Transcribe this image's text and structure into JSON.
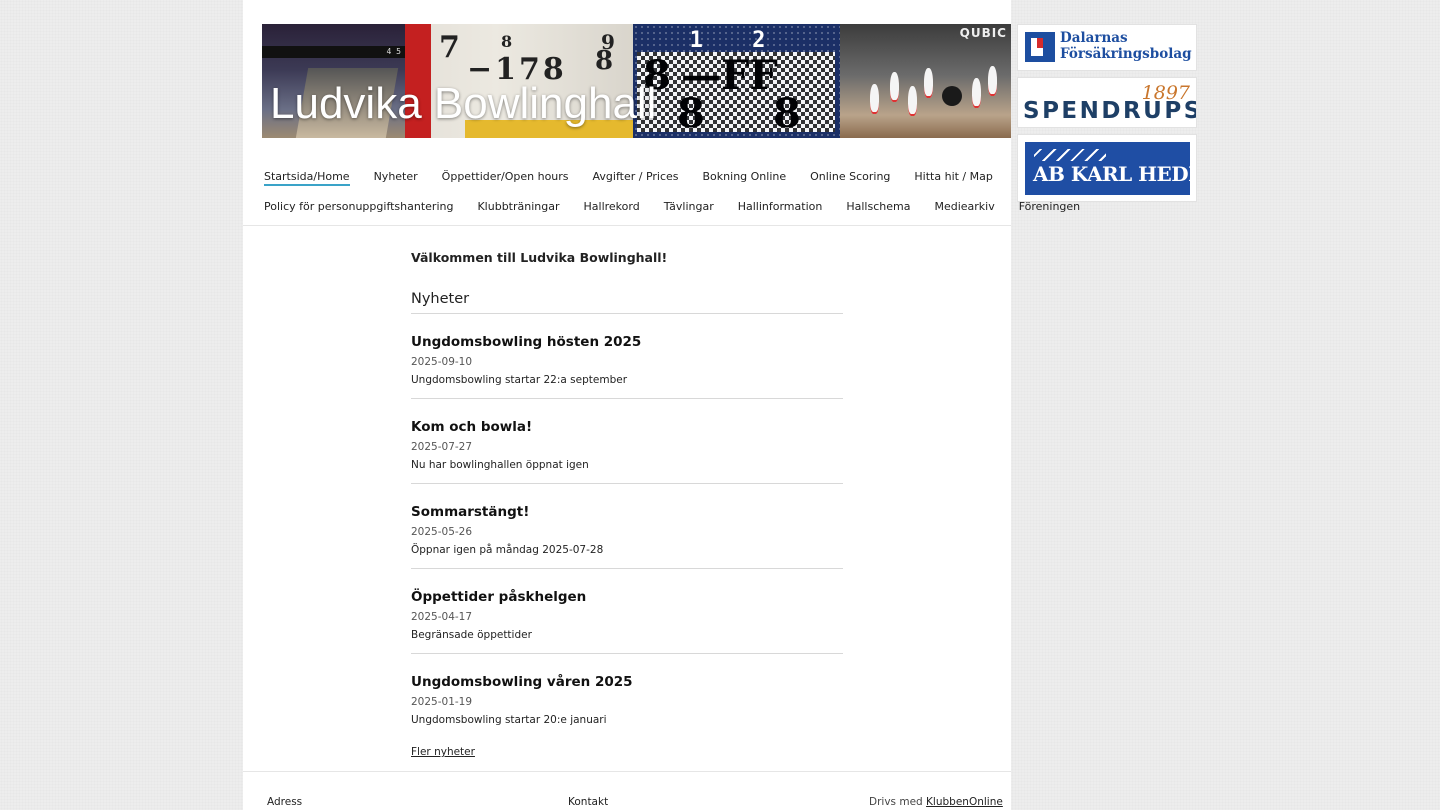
{
  "site": {
    "title": "Ludvika Bowlinghall"
  },
  "banner": {
    "panel1_strip": "4 5",
    "panel2_numbers": [
      "7",
      "8",
      "9",
      "−178",
      "8"
    ],
    "panel3_top": "1 2",
    "panel3_marks": [
      "8",
      "—FF",
      "8",
      "8"
    ],
    "panel4_brand": "QUBIC"
  },
  "nav": {
    "row1": [
      "Startsida/Home",
      "Nyheter",
      "Öppettider/Open hours",
      "Avgifter / Prices",
      "Bokning Online",
      "Online Scoring",
      "Hitta hit / Map"
    ],
    "row2": [
      "Policy för personuppgiftshantering",
      "Klubbträningar",
      "Hallrekord",
      "Tävlingar",
      "Hallinformation",
      "Hallschema",
      "Mediearkiv",
      "Föreningen"
    ]
  },
  "content": {
    "welcome": "Välkommen till Ludvika Bowlinghall!",
    "news_heading": "Nyheter",
    "news": [
      {
        "title": "Ungdomsbowling hösten 2025",
        "date": "2025-09-10",
        "summary": "Ungdomsbowling startar 22:a september"
      },
      {
        "title": "Kom och bowla!",
        "date": "2025-07-27",
        "summary": "Nu har bowlinghallen öppnat igen"
      },
      {
        "title": "Sommarstängt!",
        "date": "2025-05-26",
        "summary": "Öppnar igen på måndag 2025-07-28"
      },
      {
        "title": "Öppettider påskhelgen",
        "date": "2025-04-17",
        "summary": "Begränsade öppettider"
      },
      {
        "title": "Ungdomsbowling våren 2025",
        "date": "2025-01-19",
        "summary": "Ungdomsbowling startar 20:e januari"
      }
    ],
    "more_news": "Fler nyheter"
  },
  "footer": {
    "address_label": "Adress",
    "contact_label": "Kontakt",
    "powered_prefix": "Drivs med",
    "powered_link": "KlubbenOnline"
  },
  "sponsors": {
    "dalarnas_line1": "Dalarnas",
    "dalarnas_line2": "Försäkringsbolag",
    "spendrups_word": "SPENDRUPS",
    "spendrups_num": "1897",
    "karlhedin": "AB KARL HEDIN"
  },
  "colors": {
    "nav_active_underline": "#3aa3c8",
    "page_background": "#ededed",
    "dalarnas_blue": "#1d4ea0",
    "spendrups_navy": "#1e3f66",
    "karlhedin_blue": "#1f4ea4"
  }
}
